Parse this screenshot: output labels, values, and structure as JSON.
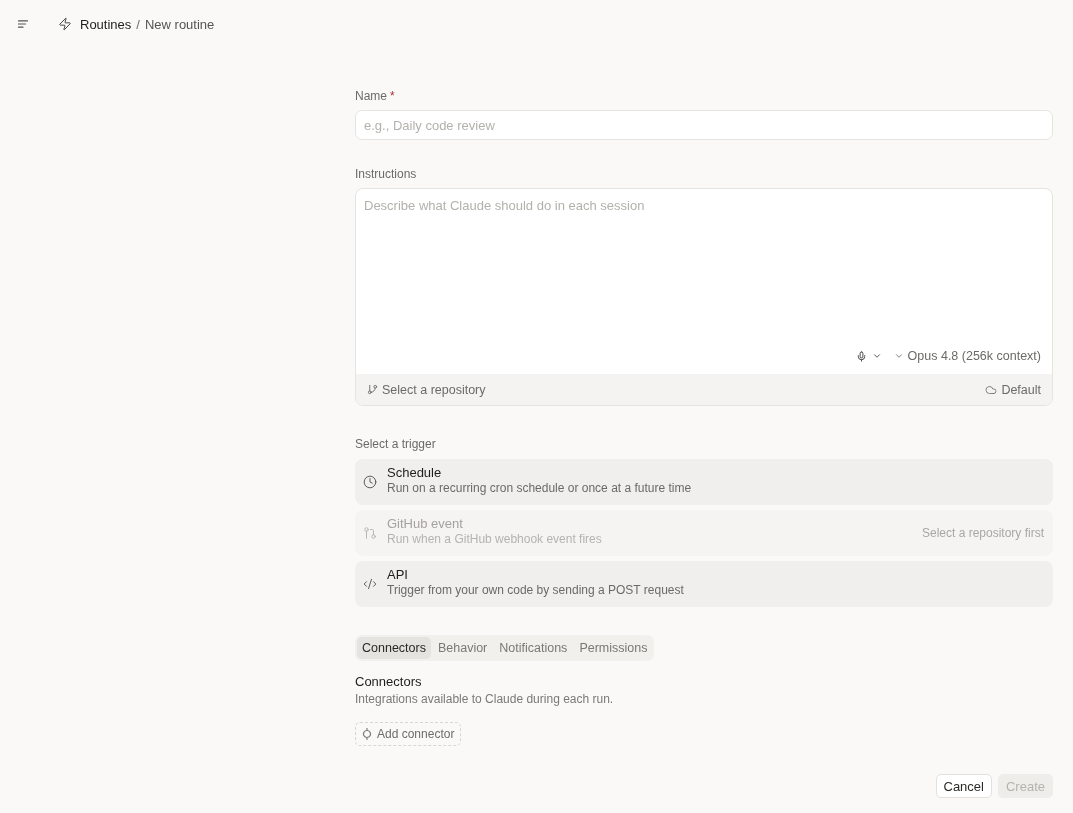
{
  "header": {
    "section": "Routines",
    "separator": "/",
    "page": "New routine"
  },
  "name_field": {
    "label": "Name",
    "required_mark": "*",
    "placeholder": "e.g., Daily code review"
  },
  "instructions": {
    "label": "Instructions",
    "placeholder": "Describe what Claude should do in each session",
    "model": "Opus 4.8 (256k context)",
    "repository": "Select a repository",
    "environment": "Default"
  },
  "trigger": {
    "label": "Select a trigger",
    "options": [
      {
        "kind": "schedule",
        "title": "Schedule",
        "description": "Run on a recurring cron schedule or once at a future time",
        "disabled": false
      },
      {
        "kind": "github",
        "title": "GitHub event",
        "description": "Run when a GitHub webhook event fires",
        "note": "Select a repository first",
        "disabled": true
      },
      {
        "kind": "api",
        "title": "API",
        "description": "Trigger from your own code by sending a POST request",
        "disabled": false
      }
    ]
  },
  "tabs": [
    {
      "label": "Connectors",
      "selected": true
    },
    {
      "label": "Behavior",
      "selected": false
    },
    {
      "label": "Notifications",
      "selected": false
    },
    {
      "label": "Permissions",
      "selected": false
    }
  ],
  "connectors": {
    "title": "Connectors",
    "description": "Integrations available to Claude during each run.",
    "add_button": "Add connector"
  },
  "actions": [
    {
      "label": "Cancel",
      "disabled": false
    },
    {
      "label": "Create",
      "disabled": true
    }
  ]
}
